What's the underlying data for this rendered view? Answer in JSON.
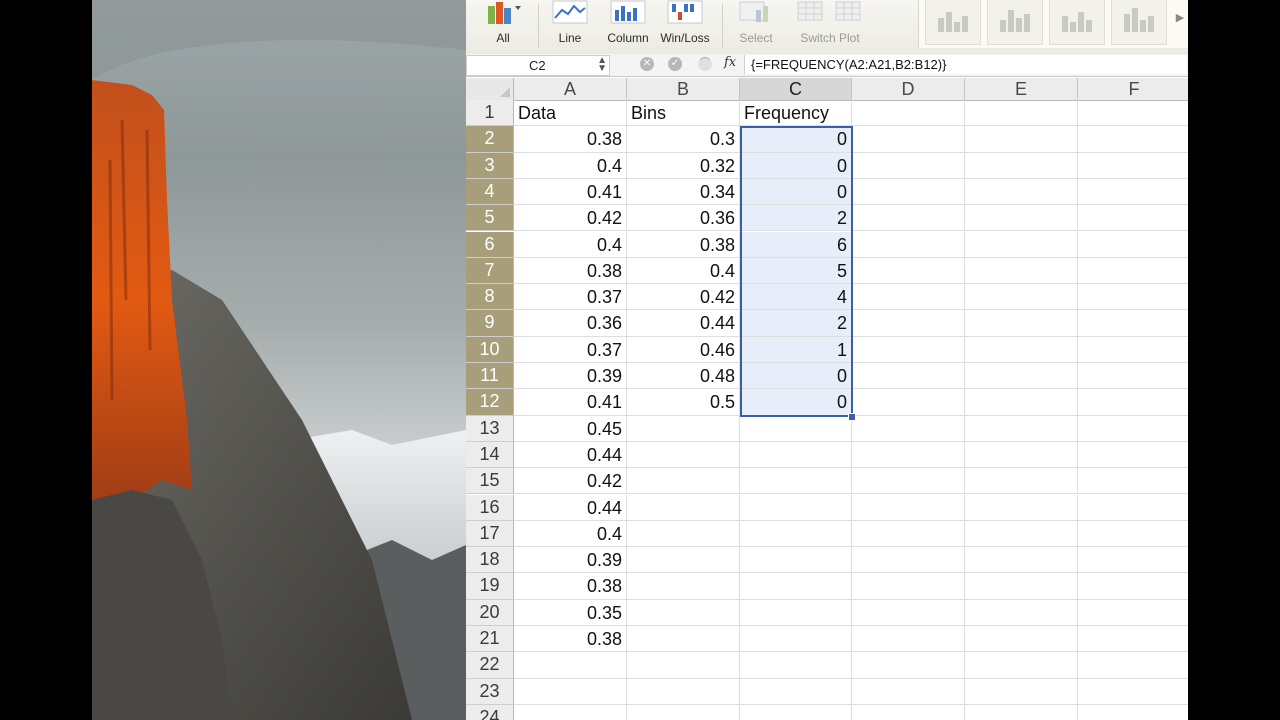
{
  "ribbon": {
    "buttons": [
      {
        "label": "All",
        "icon": "column-chart-icon"
      },
      {
        "label": "Line",
        "icon": "line-chart-icon"
      },
      {
        "label": "Column",
        "icon": "column-chart-icon"
      },
      {
        "label": "Win/Loss",
        "icon": "win-loss-chart-icon"
      },
      {
        "label": "Select",
        "icon": "select-data-icon"
      },
      {
        "label": "Switch Plot",
        "icon": "switch-plot-icon"
      }
    ]
  },
  "formula_bar": {
    "name_box": "C2",
    "formula": "{=FREQUENCY(A2:A21,B2:B12)}",
    "fx_label": "fx"
  },
  "sheet": {
    "columns": [
      "A",
      "B",
      "C",
      "D",
      "E",
      "F"
    ],
    "selected_column": "C",
    "rows": [
      {
        "n": "1",
        "a": "Data",
        "b": "Bins",
        "c": "Frequency"
      },
      {
        "n": "2",
        "a": "0.38",
        "b": "0.3",
        "c": "0"
      },
      {
        "n": "3",
        "a": "0.4",
        "b": "0.32",
        "c": "0"
      },
      {
        "n": "4",
        "a": "0.41",
        "b": "0.34",
        "c": "0"
      },
      {
        "n": "5",
        "a": "0.42",
        "b": "0.36",
        "c": "2"
      },
      {
        "n": "6",
        "a": "0.4",
        "b": "0.38",
        "c": "6"
      },
      {
        "n": "7",
        "a": "0.38",
        "b": "0.4",
        "c": "5"
      },
      {
        "n": "8",
        "a": "0.37",
        "b": "0.42",
        "c": "4"
      },
      {
        "n": "9",
        "a": "0.36",
        "b": "0.44",
        "c": "2"
      },
      {
        "n": "10",
        "a": "0.37",
        "b": "0.46",
        "c": "1"
      },
      {
        "n": "11",
        "a": "0.39",
        "b": "0.48",
        "c": "0"
      },
      {
        "n": "12",
        "a": "0.41",
        "b": "0.5",
        "c": "0"
      },
      {
        "n": "13",
        "a": "0.45",
        "b": "",
        "c": ""
      },
      {
        "n": "14",
        "a": "0.44",
        "b": "",
        "c": ""
      },
      {
        "n": "15",
        "a": "0.42",
        "b": "",
        "c": ""
      },
      {
        "n": "16",
        "a": "0.44",
        "b": "",
        "c": ""
      },
      {
        "n": "17",
        "a": "0.4",
        "b": "",
        "c": ""
      },
      {
        "n": "18",
        "a": "0.39",
        "b": "",
        "c": ""
      },
      {
        "n": "19",
        "a": "0.38",
        "b": "",
        "c": ""
      },
      {
        "n": "20",
        "a": "0.35",
        "b": "",
        "c": ""
      },
      {
        "n": "21",
        "a": "0.38",
        "b": "",
        "c": ""
      },
      {
        "n": "22",
        "a": "",
        "b": "",
        "c": ""
      },
      {
        "n": "23",
        "a": "",
        "b": "",
        "c": ""
      },
      {
        "n": "24",
        "a": "",
        "b": "",
        "c": ""
      }
    ]
  },
  "colors": {
    "selection_border": "#3a5dae",
    "selection_fill": "#e8eef9",
    "selected_row_header": "#a89f7a"
  }
}
